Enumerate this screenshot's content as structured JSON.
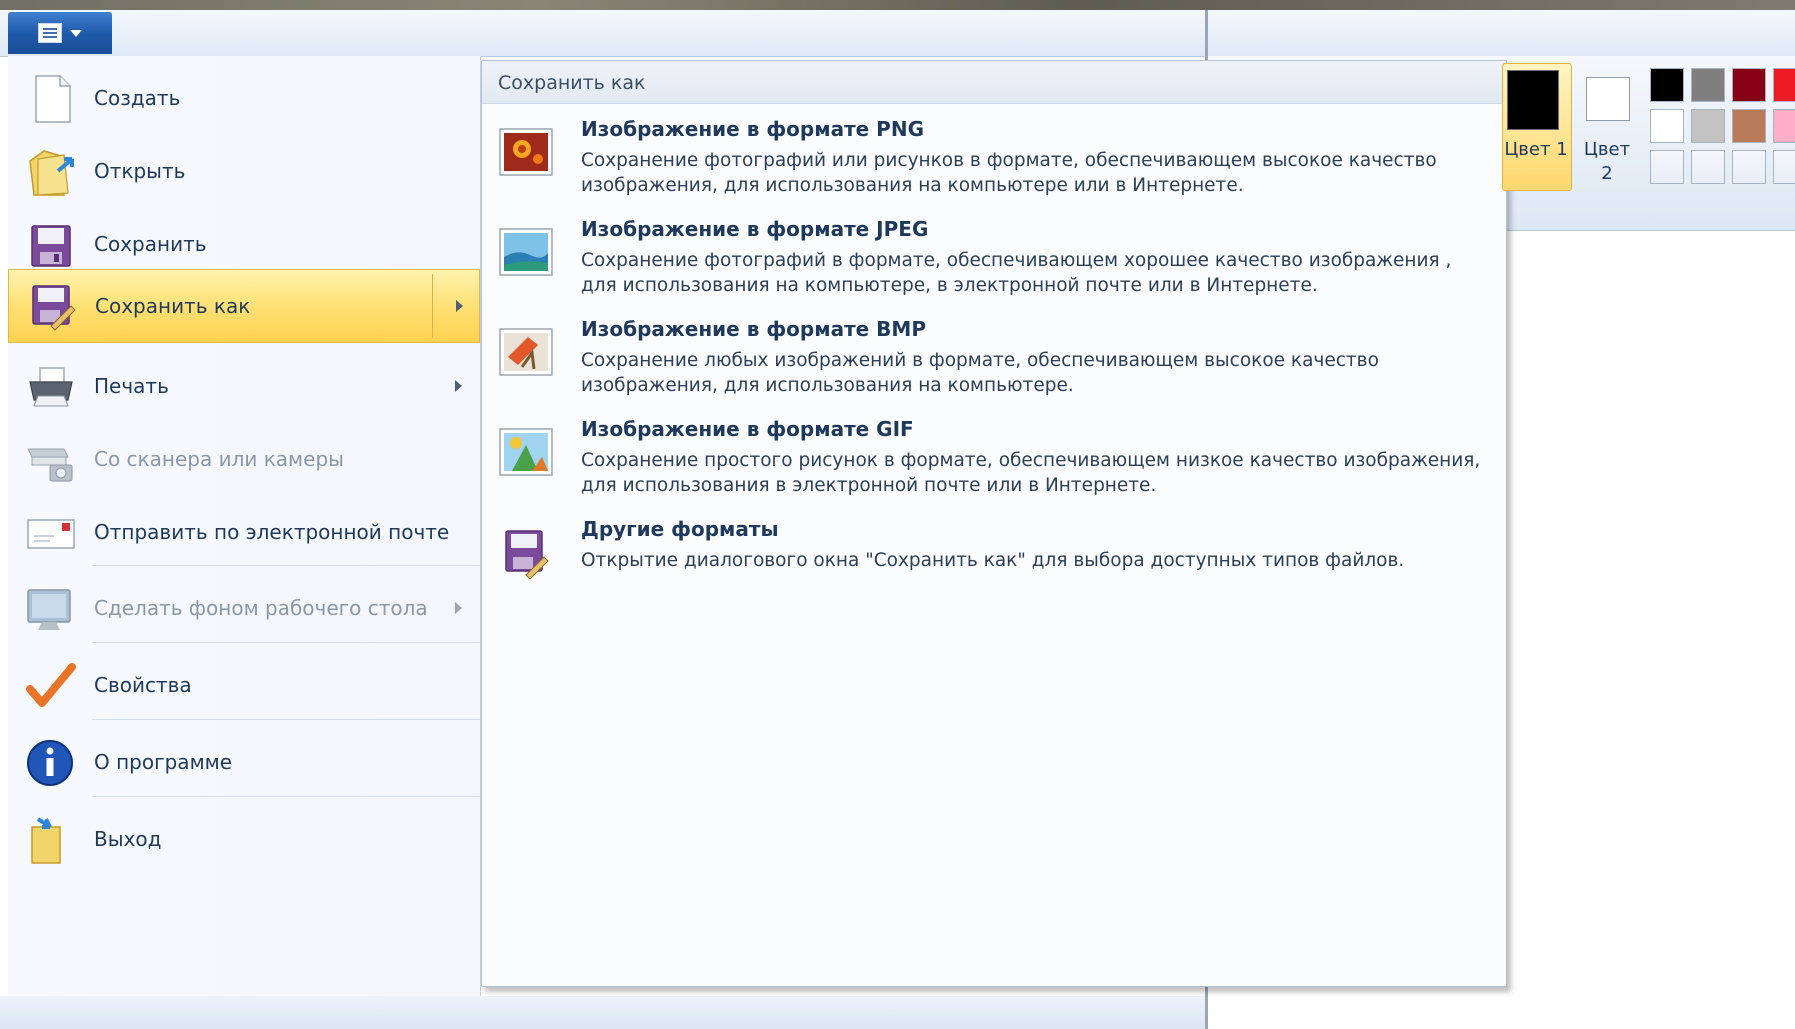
{
  "left_menu": {
    "items": [
      {
        "label": "Создать",
        "icon": "new-document-icon",
        "disabled": false,
        "has_submenu": false,
        "active": false
      },
      {
        "label": "Открыть",
        "icon": "open-folder-icon",
        "disabled": false,
        "has_submenu": false,
        "active": false
      },
      {
        "label": "Сохранить",
        "icon": "floppy-disk-icon",
        "disabled": false,
        "has_submenu": false,
        "active": false
      },
      {
        "label": "Сохранить как",
        "icon": "save-as-icon",
        "disabled": false,
        "has_submenu": true,
        "active": true
      },
      {
        "label": "Печать",
        "icon": "printer-icon",
        "disabled": false,
        "has_submenu": true,
        "active": false
      },
      {
        "label": "Со сканера или камеры",
        "icon": "scanner-camera-icon",
        "disabled": true,
        "has_submenu": false,
        "active": false
      },
      {
        "label": "Отправить по электронной почте",
        "icon": "email-envelope-icon",
        "disabled": false,
        "has_submenu": false,
        "active": false
      },
      {
        "label": "Сделать фоном рабочего стола",
        "icon": "desktop-monitor-icon",
        "disabled": true,
        "has_submenu": true,
        "active": false
      },
      {
        "label": "Свойства",
        "icon": "checkmark-icon",
        "disabled": false,
        "has_submenu": false,
        "active": false
      },
      {
        "label": "О программе",
        "icon": "info-icon",
        "disabled": false,
        "has_submenu": false,
        "active": false
      },
      {
        "label": "Выход",
        "icon": "exit-icon",
        "disabled": false,
        "has_submenu": false,
        "active": false
      }
    ]
  },
  "submenu": {
    "title": "Сохранить как",
    "formats": [
      {
        "title": "Изображение в формате PNG",
        "icon": "png-image-icon",
        "description": "Сохранение фотографий или рисунков в формате, обеспечивающем высокое качество изображения, для использования на компьютере или в Интернете."
      },
      {
        "title": "Изображение в формате JPEG",
        "icon": "jpeg-image-icon",
        "description": "Сохранение фотографий в формате, обеспечивающем хорошее качество изображения , для использования на компьютере, в электронной почте или в Интернете."
      },
      {
        "title": "Изображение в формате BMP",
        "icon": "bmp-image-icon",
        "description": "Сохранение любых изображений в формате, обеспечивающем высокое качество изображения, для использования на компьютере."
      },
      {
        "title": "Изображение в формате GIF",
        "icon": "gif-image-icon",
        "description": "Сохранение простого рисунок в формате, обеспечивающем низкое качество изображения, для использования в электронной почте или в Интернете."
      },
      {
        "title": "Другие форматы",
        "icon": "other-formats-icon",
        "description": "Открытие диалогового окна \"Сохранить как\" для выбора доступных типов файлов."
      }
    ]
  },
  "ribbon": {
    "color1_label": "Цвет 1",
    "color2_label": "Цвет 2",
    "color1_value": "#000000",
    "color2_value": "#ffffff",
    "palette": [
      [
        "#000000",
        "#7f7f7f",
        "#880015",
        "#ed1c24"
      ],
      [
        "#ffffff",
        "#c3c3c3",
        "#b97a57",
        "#ffaec9"
      ],
      [
        "",
        "",
        "",
        ""
      ]
    ]
  },
  "colors": {
    "accent": "#1e58a8",
    "highlight": "#ffd24f",
    "text": "#1e395b"
  }
}
